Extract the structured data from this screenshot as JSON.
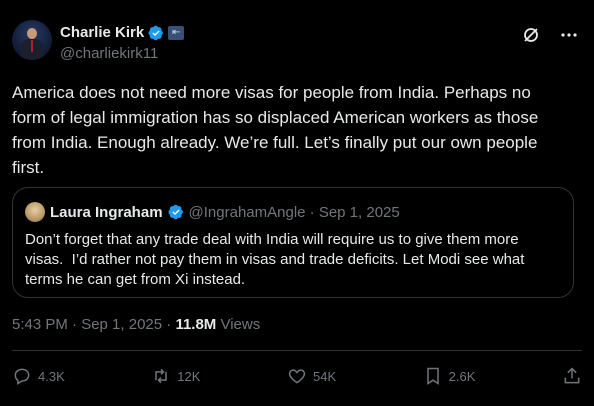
{
  "author": {
    "name": "Charlie Kirk",
    "handle": "@charliekirk11"
  },
  "tweet": {
    "text": "America does not need more visas for people from India. Perhaps no\nform of legal immigration has so displaced American workers as those\nfrom India. Enough already. We’re full. Let’s finally put our own people\nfirst."
  },
  "quote": {
    "name": "Laura Ingraham",
    "handle_date": "@IngrahamAngle · Sep 1, 2025",
    "text": "Don’t forget that any trade deal with India will require us to give them more\nvisas.  I’d rather not pay them in visas and trade deficits. Let Modi see what\nterms he can get from Xi instead."
  },
  "meta": {
    "time_date": "5:43 PM · Sep 1, 2025 · ",
    "views_count": "11.8M",
    "views_label": " Views"
  },
  "actions": {
    "replies": "4.3K",
    "reposts": "12K",
    "likes": "54K",
    "bookmarks": "2.6K"
  },
  "colors": {
    "background": "#000000",
    "verified": "#1d9bf0",
    "muted": "#71767b"
  }
}
